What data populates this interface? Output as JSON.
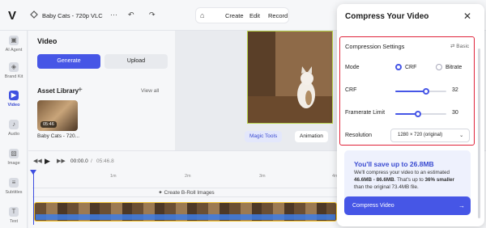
{
  "app": {
    "logo": "V",
    "project_title": "Baby Cats - 720p VLC",
    "more": "···",
    "undo": "↶",
    "redo": "↷"
  },
  "menu": {
    "home_icon": "⌂",
    "create": "Create",
    "edit": "Edit",
    "record": "Record"
  },
  "rail": [
    {
      "label": "AI Agent",
      "icon": "▣"
    },
    {
      "label": "Brand Kit",
      "icon": "◈"
    },
    {
      "label": "Video",
      "icon": "▶"
    },
    {
      "label": "Audio",
      "icon": "♪"
    },
    {
      "label": "Image",
      "icon": "▧"
    },
    {
      "label": "Subtitles",
      "icon": "≡"
    },
    {
      "label": "Text",
      "icon": "T"
    }
  ],
  "left_panel": {
    "heading": "Video",
    "generate_label": "Generate",
    "upload_label": "Upload",
    "asset_library": "Asset Library",
    "add": "+",
    "view_all": "View all",
    "asset_duration": "05:46",
    "asset_name": "Baby Cats - 720..."
  },
  "preview": {
    "magic_tools": "Magic Tools",
    "animation": "Animation"
  },
  "timeline": {
    "time_current": "00:00.0",
    "time_sep": "/",
    "time_total": "05:46.8",
    "ticks": [
      "1m",
      "2m",
      "3m",
      "4m"
    ],
    "broll_label": "✦ Create B-Roll Images"
  },
  "dialog": {
    "title": "Compress Your Video",
    "close": "✕",
    "settings_heading": "Compression Settings",
    "basic_label": "Basic",
    "mode_label": "Mode",
    "mode_crf": "CRF",
    "mode_bitrate": "Bitrate",
    "mode_selected": "CRF",
    "crf_label": "CRF",
    "crf_value": "32",
    "crf_fraction": 0.6,
    "framerate_label": "Framerate Limit",
    "framerate_value": "30",
    "framerate_fraction": 0.45,
    "resolution_label": "Resolution",
    "resolution_value": "1280 × 720 (original)",
    "savings_heading": "You'll save up to 26.8MB",
    "savings_line1": "We'll compress your video to an estimated",
    "savings_bold": "46.6MB - 86.6MB",
    "savings_line2": ". That's up to ",
    "savings_pct": "36% smaller",
    "savings_line3": "than the original 73.4MB file.",
    "compress_label": "Compress Video",
    "compress_arrow": "→"
  },
  "colors": {
    "accent": "#4656e6",
    "highlight_border": "#e0233a",
    "track_border": "#f1c232"
  }
}
